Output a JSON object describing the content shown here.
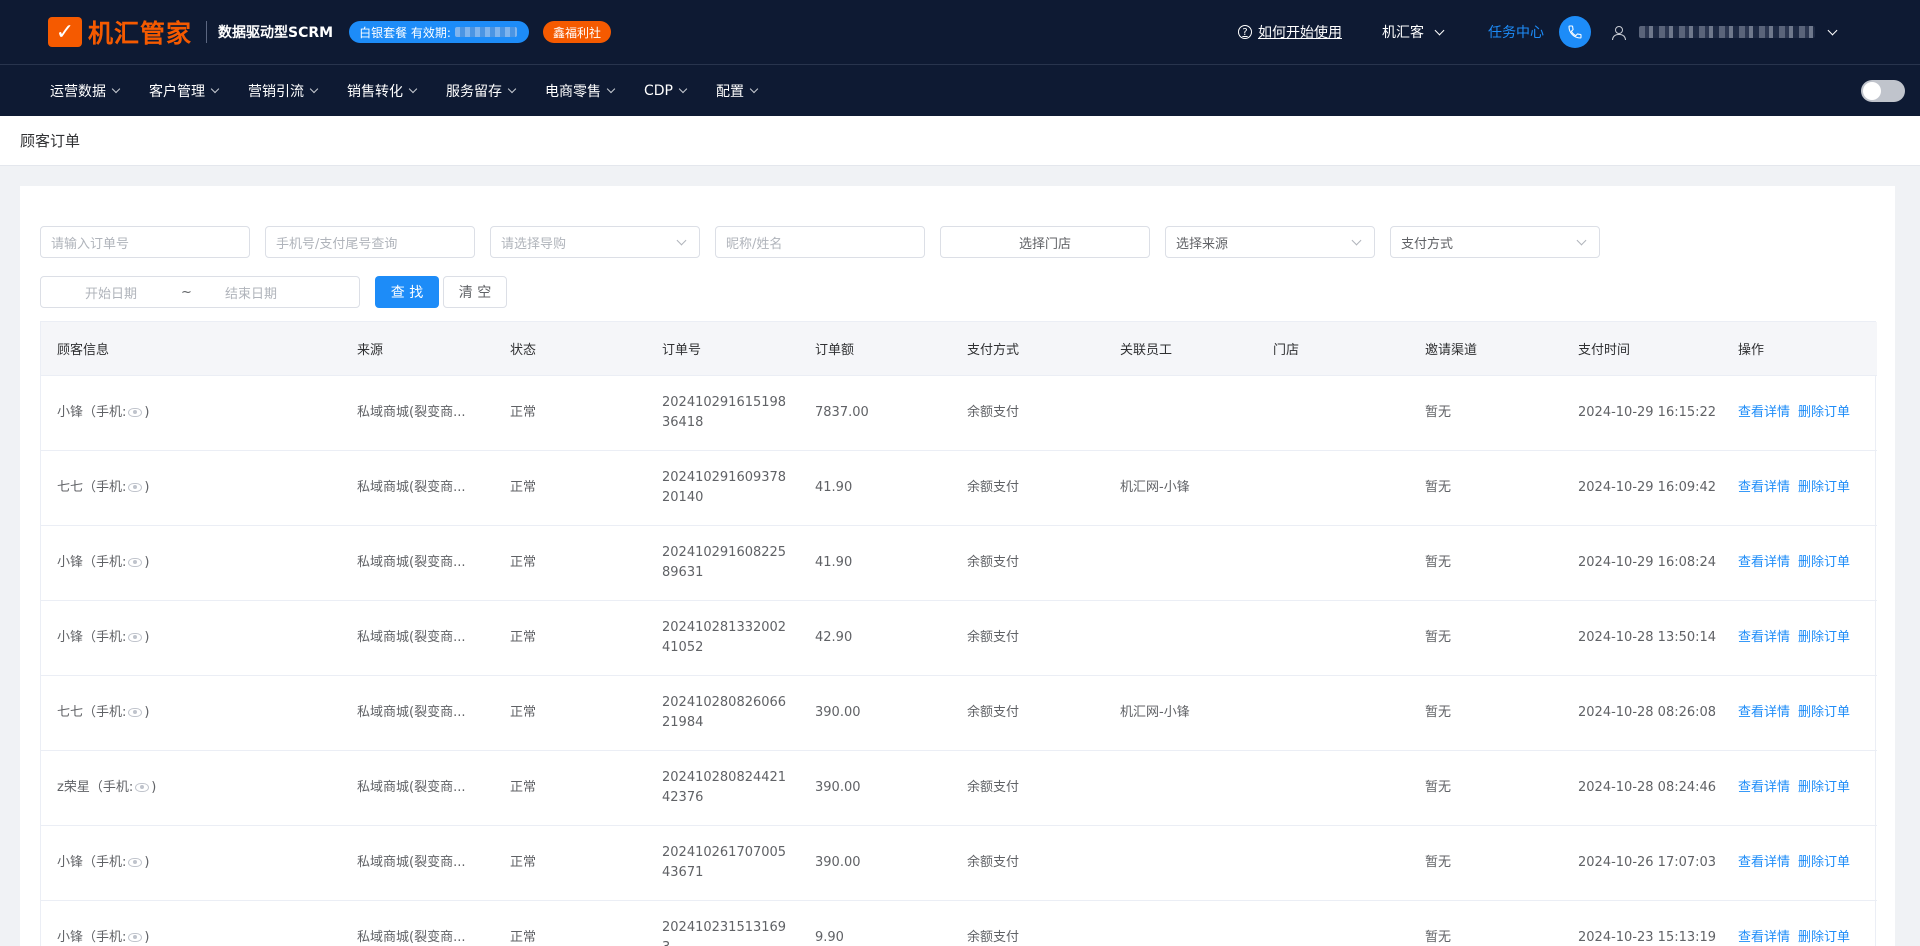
{
  "header": {
    "logo_glyph": "✓",
    "logo_text": "机汇管家",
    "slogan": "数据驱动型SCRM",
    "package_label": "白银套餐 有效期:",
    "welfare_label": "鑫福利社",
    "howto_label": "如何开始使用",
    "org_name": "机汇客",
    "task_center": "任务中心"
  },
  "nav": {
    "items": [
      "运营数据",
      "客户管理",
      "营销引流",
      "销售转化",
      "服务留存",
      "电商零售",
      "CDP",
      "配置"
    ]
  },
  "breadcrumb": "顾客订单",
  "filters": {
    "order_no_placeholder": "请输入订单号",
    "phone_placeholder": "手机号/支付尾号查询",
    "guide_placeholder": "请选择导购",
    "nickname_placeholder": "昵称/姓名",
    "store_label": "选择门店",
    "source_placeholder": "选择来源",
    "pay_method_value": "支付方式",
    "start_date": "开始日期",
    "range_sep": "~",
    "end_date": "结束日期",
    "search_label": "查 找",
    "clear_label": "清 空"
  },
  "table": {
    "columns": [
      "顾客信息",
      "来源",
      "状态",
      "订单号",
      "订单额",
      "支付方式",
      "关联员工",
      "门店",
      "邀请渠道",
      "支付时间",
      "操作"
    ],
    "view_label": "查看详情",
    "delete_label": "删除订单",
    "rows": [
      {
        "name": "小锋（手机:",
        "close": ")",
        "source": "私域商城(裂变商...",
        "status": "正常",
        "order_no": "20241029161519836418",
        "amount": "7837.00",
        "pay": "余额支付",
        "staff": "",
        "store": "",
        "channel": "暂无",
        "time": "2024-10-29 16:15:22"
      },
      {
        "name": "七七（手机:",
        "close": ")",
        "source": "私域商城(裂变商...",
        "status": "正常",
        "order_no": "20241029160937820140",
        "amount": "41.90",
        "pay": "余额支付",
        "staff": "机汇网-小锋",
        "store": "",
        "channel": "暂无",
        "time": "2024-10-29 16:09:42"
      },
      {
        "name": "小锋（手机:",
        "close": ")",
        "source": "私域商城(裂变商...",
        "status": "正常",
        "order_no": "20241029160822589631",
        "amount": "41.90",
        "pay": "余额支付",
        "staff": "",
        "store": "",
        "channel": "暂无",
        "time": "2024-10-29 16:08:24"
      },
      {
        "name": "小锋（手机:",
        "close": ")",
        "source": "私域商城(裂变商...",
        "status": "正常",
        "order_no": "20241028133200241052",
        "amount": "42.90",
        "pay": "余额支付",
        "staff": "",
        "store": "",
        "channel": "暂无",
        "time": "2024-10-28 13:50:14"
      },
      {
        "name": "七七（手机:",
        "close": ")",
        "source": "私域商城(裂变商...",
        "status": "正常",
        "order_no": "20241028082606621984",
        "amount": "390.00",
        "pay": "余额支付",
        "staff": "机汇网-小锋",
        "store": "",
        "channel": "暂无",
        "time": "2024-10-28 08:26:08"
      },
      {
        "name": "z荣星（手机:",
        "close": ")",
        "source": "私域商城(裂变商...",
        "status": "正常",
        "order_no": "20241028082442142376",
        "amount": "390.00",
        "pay": "余额支付",
        "staff": "",
        "store": "",
        "channel": "暂无",
        "time": "2024-10-28 08:24:46"
      },
      {
        "name": "小锋（手机:",
        "close": ")",
        "source": "私域商城(裂变商...",
        "status": "正常",
        "order_no": "20241026170700543671",
        "amount": "390.00",
        "pay": "余额支付",
        "staff": "",
        "store": "",
        "channel": "暂无",
        "time": "2024-10-26 17:07:03"
      },
      {
        "name": "小锋（手机:",
        "close": ")",
        "source": "私域商城(裂变商...",
        "status": "正常",
        "order_no": "2024102315131693",
        "amount": "9.90",
        "pay": "余额支付",
        "staff": "",
        "store": "",
        "channel": "暂无",
        "time": "2024-10-23 15:13:19"
      }
    ]
  },
  "colors": {
    "header_bg": "#0e1a33",
    "brand_orange": "#f55a00",
    "accent_blue": "#1d8cf8"
  }
}
